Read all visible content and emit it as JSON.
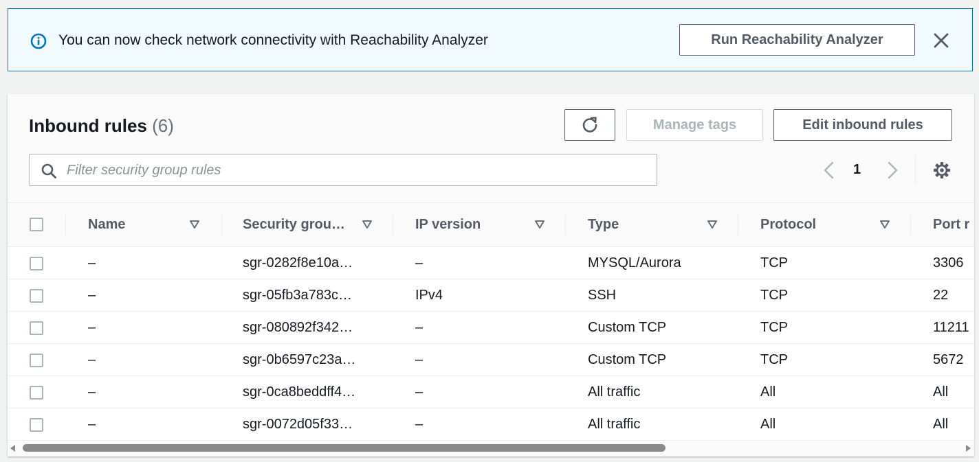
{
  "banner": {
    "message": "You can now check network connectivity with Reachability Analyzer",
    "button_label": "Run Reachability Analyzer",
    "icon": "info-icon",
    "close_icon": "close-icon"
  },
  "panel": {
    "title": "Inbound rules",
    "count": "(6)",
    "buttons": {
      "refresh_icon": "refresh-icon",
      "manage_tags": "Manage tags",
      "edit_rules": "Edit inbound rules"
    },
    "filter": {
      "placeholder": "Filter security group rules",
      "value": ""
    },
    "pagination": {
      "current_page": "1"
    }
  },
  "table": {
    "columns": [
      "Name",
      "Security grou…",
      "IP version",
      "Type",
      "Protocol",
      "Port r"
    ],
    "rows": [
      {
        "name": "–",
        "sgr": "sgr-0282f8e10a…",
        "ip": "–",
        "type": "MYSQL/Aurora",
        "protocol": "TCP",
        "port": "3306"
      },
      {
        "name": "–",
        "sgr": "sgr-05fb3a783c…",
        "ip": "IPv4",
        "type": "SSH",
        "protocol": "TCP",
        "port": "22"
      },
      {
        "name": "–",
        "sgr": "sgr-080892f342…",
        "ip": "–",
        "type": "Custom TCP",
        "protocol": "TCP",
        "port": "11211"
      },
      {
        "name": "–",
        "sgr": "sgr-0b6597c23a…",
        "ip": "–",
        "type": "Custom TCP",
        "protocol": "TCP",
        "port": "5672"
      },
      {
        "name": "–",
        "sgr": "sgr-0ca8beddff4…",
        "ip": "–",
        "type": "All traffic",
        "protocol": "All",
        "port": "All"
      },
      {
        "name": "–",
        "sgr": "sgr-0072d05f33…",
        "ip": "–",
        "type": "All traffic",
        "protocol": "All",
        "port": "All"
      }
    ]
  },
  "colors": {
    "banner_border": "#0073bb",
    "banner_bg": "#f1faff",
    "text_primary": "#16191f",
    "text_secondary": "#545b64",
    "disabled": "#aab7b8"
  }
}
